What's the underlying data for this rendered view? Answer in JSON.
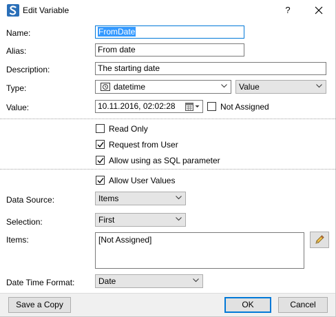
{
  "window": {
    "title": "Edit Variable",
    "help_label": "?"
  },
  "form": {
    "name_label": "Name:",
    "name_value": "FromDate",
    "alias_label": "Alias:",
    "alias_value": "From date",
    "description_label": "Description:",
    "description_value": "The starting date",
    "type_label": "Type:",
    "type_value": "datetime",
    "type_icon": "clock-icon",
    "type_kind_value": "Value",
    "value_label": "Value:",
    "value_value": "10.11.2016, 02:02:28",
    "not_assigned_label": "Not Assigned",
    "not_assigned_checked": false
  },
  "options": {
    "read_only_label": "Read Only",
    "read_only_checked": false,
    "request_from_user_label": "Request from User",
    "request_from_user_checked": true,
    "allow_sql_label": "Allow using as SQL parameter",
    "allow_sql_checked": true
  },
  "user_values": {
    "allow_user_values_label": "Allow User Values",
    "allow_user_values_checked": true,
    "data_source_label": "Data Source:",
    "data_source_value": "Items",
    "selection_label": "Selection:",
    "selection_value": "First",
    "items_label": "Items:",
    "items_value": "[Not Assigned]",
    "date_time_format_label": "Date Time Format:",
    "date_time_format_value": "Date"
  },
  "footer": {
    "save_copy_label": "Save a Copy",
    "ok_label": "OK",
    "cancel_label": "Cancel"
  },
  "colors": {
    "accent": "#0078d7",
    "selection": "#3399ff",
    "footer_bg": "#f0f0f0",
    "app_icon": "#2a6fb8"
  }
}
